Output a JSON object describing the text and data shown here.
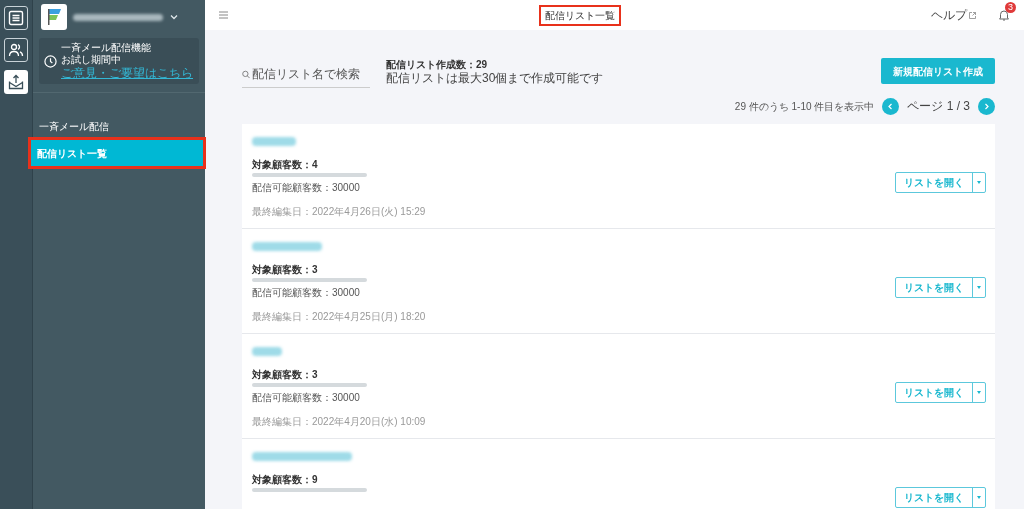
{
  "rail": [
    {
      "kind": "list",
      "selected": false
    },
    {
      "kind": "people",
      "selected": false
    },
    {
      "kind": "mail",
      "selected": true
    }
  ],
  "trial": {
    "line1": "一斉メール配信機能",
    "line2": "お試し期間中",
    "link": "ご意見・ご要望はこちら"
  },
  "nav": {
    "section": "一斉メール配信",
    "items": [
      {
        "label": "配信リスト一覧",
        "selected": true,
        "highlighted": true
      }
    ]
  },
  "header": {
    "title": "配信リスト一覧",
    "title_highlighted": true,
    "help": "ヘルプ",
    "badge": "3"
  },
  "search": {
    "placeholder": "配信リスト名で検索"
  },
  "summary": {
    "count": "配信リスト作成数：29",
    "note": "配信リストは最大30個まで作成可能です"
  },
  "create_button": "新規配信リスト作成",
  "pagination": {
    "info": "29 件のうち 1-10 件目を表示中",
    "page": "ページ 1 / 3"
  },
  "lists": [
    {
      "target": "対象顧客数：4",
      "capacity": "配信可能顧客数：30000",
      "edited": "最終編集日：2022年4月26日(火) 15:29",
      "open": "リストを開く"
    },
    {
      "target": "対象顧客数：3",
      "capacity": "配信可能顧客数：30000",
      "edited": "最終編集日：2022年4月25日(月) 18:20",
      "open": "リストを開く"
    },
    {
      "target": "対象顧客数：3",
      "capacity": "配信可能顧客数：30000",
      "edited": "最終編集日：2022年4月20日(水) 10:09",
      "open": "リストを開く"
    },
    {
      "target": "対象顧客数：9",
      "open": "リストを開く"
    }
  ]
}
